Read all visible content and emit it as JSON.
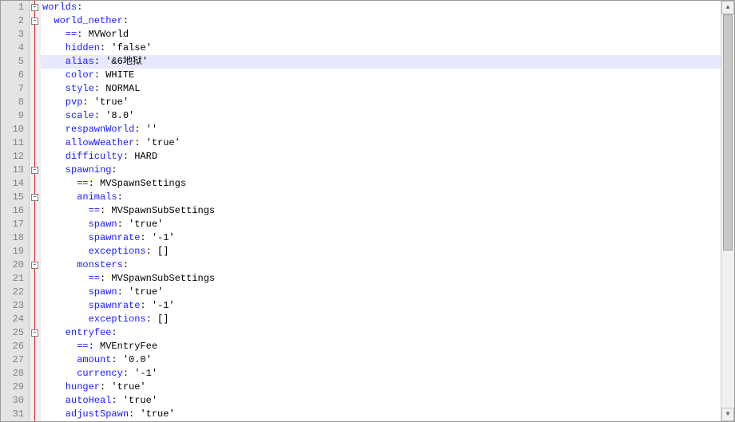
{
  "highlighted_line": 5,
  "lines": [
    {
      "n": 1,
      "fold": "box",
      "indent": 0,
      "key": "worlds",
      "colon": ":",
      "val": ""
    },
    {
      "n": 2,
      "fold": "box",
      "indent": 1,
      "key": "world_nether",
      "colon": ":",
      "val": ""
    },
    {
      "n": 3,
      "fold": "line",
      "indent": 2,
      "key": "==",
      "colon": ": ",
      "val": "MVWorld"
    },
    {
      "n": 4,
      "fold": "line",
      "indent": 2,
      "key": "hidden",
      "colon": ": ",
      "val": "'false'"
    },
    {
      "n": 5,
      "fold": "line",
      "indent": 2,
      "key": "alias",
      "colon": ": ",
      "val": "'&6地狱'"
    },
    {
      "n": 6,
      "fold": "line",
      "indent": 2,
      "key": "color",
      "colon": ": ",
      "val": "WHITE"
    },
    {
      "n": 7,
      "fold": "line",
      "indent": 2,
      "key": "style",
      "colon": ": ",
      "val": "NORMAL"
    },
    {
      "n": 8,
      "fold": "line",
      "indent": 2,
      "key": "pvp",
      "colon": ": ",
      "val": "'true'"
    },
    {
      "n": 9,
      "fold": "line",
      "indent": 2,
      "key": "scale",
      "colon": ": ",
      "val": "'8.0'"
    },
    {
      "n": 10,
      "fold": "line",
      "indent": 2,
      "key": "respawnWorld",
      "colon": ": ",
      "val": "''"
    },
    {
      "n": 11,
      "fold": "line",
      "indent": 2,
      "key": "allowWeather",
      "colon": ": ",
      "val": "'true'"
    },
    {
      "n": 12,
      "fold": "line",
      "indent": 2,
      "key": "difficulty",
      "colon": ": ",
      "val": "HARD"
    },
    {
      "n": 13,
      "fold": "box",
      "indent": 2,
      "key": "spawning",
      "colon": ":",
      "val": ""
    },
    {
      "n": 14,
      "fold": "line",
      "indent": 3,
      "key": "==",
      "colon": ": ",
      "val": "MVSpawnSettings"
    },
    {
      "n": 15,
      "fold": "box",
      "indent": 3,
      "key": "animals",
      "colon": ":",
      "val": ""
    },
    {
      "n": 16,
      "fold": "line",
      "indent": 4,
      "key": "==",
      "colon": ": ",
      "val": "MVSpawnSubSettings"
    },
    {
      "n": 17,
      "fold": "line",
      "indent": 4,
      "key": "spawn",
      "colon": ": ",
      "val": "'true'"
    },
    {
      "n": 18,
      "fold": "line",
      "indent": 4,
      "key": "spawnrate",
      "colon": ": ",
      "val": "'-1'"
    },
    {
      "n": 19,
      "fold": "line",
      "indent": 4,
      "key": "exceptions",
      "colon": ": ",
      "val": "[]"
    },
    {
      "n": 20,
      "fold": "box",
      "indent": 3,
      "key": "monsters",
      "colon": ":",
      "val": ""
    },
    {
      "n": 21,
      "fold": "line",
      "indent": 4,
      "key": "==",
      "colon": ": ",
      "val": "MVSpawnSubSettings"
    },
    {
      "n": 22,
      "fold": "line",
      "indent": 4,
      "key": "spawn",
      "colon": ": ",
      "val": "'true'"
    },
    {
      "n": 23,
      "fold": "line",
      "indent": 4,
      "key": "spawnrate",
      "colon": ": ",
      "val": "'-1'"
    },
    {
      "n": 24,
      "fold": "line",
      "indent": 4,
      "key": "exceptions",
      "colon": ": ",
      "val": "[]"
    },
    {
      "n": 25,
      "fold": "box",
      "indent": 2,
      "key": "entryfee",
      "colon": ":",
      "val": ""
    },
    {
      "n": 26,
      "fold": "line",
      "indent": 3,
      "key": "==",
      "colon": ": ",
      "val": "MVEntryFee"
    },
    {
      "n": 27,
      "fold": "line",
      "indent": 3,
      "key": "amount",
      "colon": ": ",
      "val": "'0.0'"
    },
    {
      "n": 28,
      "fold": "line",
      "indent": 3,
      "key": "currency",
      "colon": ": ",
      "val": "'-1'"
    },
    {
      "n": 29,
      "fold": "line",
      "indent": 2,
      "key": "hunger",
      "colon": ": ",
      "val": "'true'"
    },
    {
      "n": 30,
      "fold": "line",
      "indent": 2,
      "key": "autoHeal",
      "colon": ": ",
      "val": "'true'"
    },
    {
      "n": 31,
      "fold": "line",
      "indent": 2,
      "key": "adjustSpawn",
      "colon": ": ",
      "val": "'true'"
    }
  ],
  "scrollbar": {
    "up": "▲",
    "down": "▼"
  }
}
